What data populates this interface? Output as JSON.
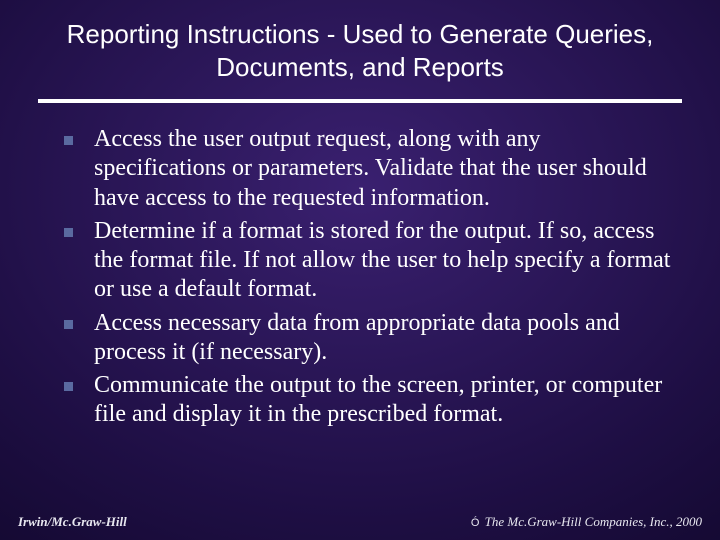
{
  "title": "Reporting Instructions - Used to Generate Queries, Documents, and Reports",
  "bullets": [
    "Access the user output request, along with any specifications or parameters.  Validate that the user should have access to the requested information.",
    "Determine if a format is stored for the output.  If so, access the format file.  If not allow the user to help specify a format or use a default format.",
    "Access necessary data from appropriate data pools and process it (if necessary).",
    "Communicate the output to the screen, printer, or computer file and display it in the prescribed format."
  ],
  "footer": {
    "left": "Irwin/Mc.Graw-Hill",
    "right_symbol": "Ó",
    "right_text": " The Mc.Graw-Hill Companies, Inc., 2000"
  }
}
